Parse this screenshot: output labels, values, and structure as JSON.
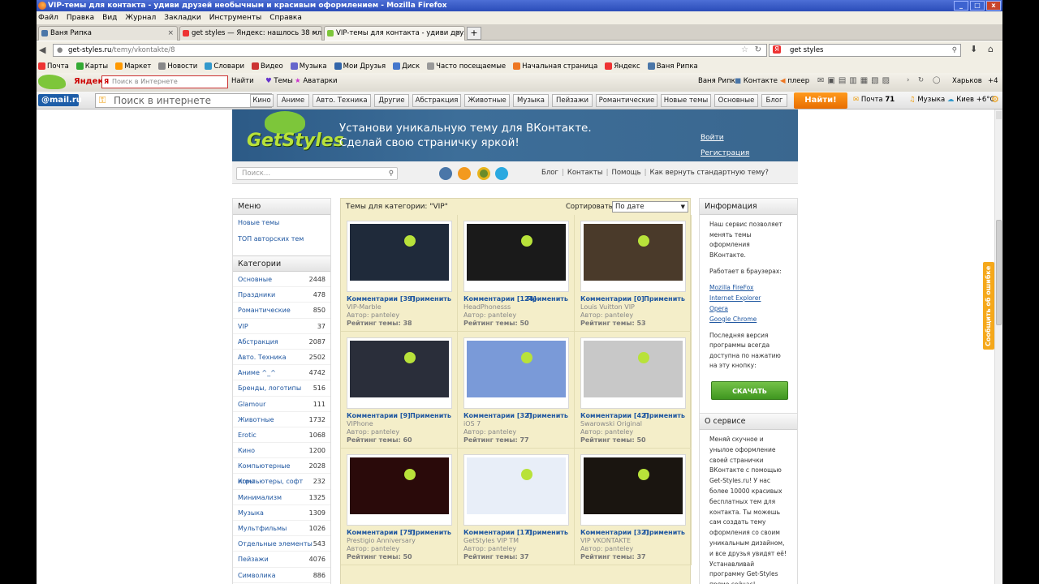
{
  "window": {
    "title": "VIP-темы для контакта - удиви друзей необычным и красивым оформлением - Mozilla Firefox",
    "controls": [
      "_",
      "□",
      "x"
    ]
  },
  "menubar": [
    "Файл",
    "Правка",
    "Вид",
    "Журнал",
    "Закладки",
    "Инструменты",
    "Справка"
  ],
  "tabs": [
    {
      "label": "Ваня Рипка",
      "close": "×"
    },
    {
      "label": "get styles — Яндекс: нашлось 38 млн о...",
      "close": "×"
    },
    {
      "label": "VIP-темы для контакта - удиви друзе...",
      "close": "×"
    }
  ],
  "newtab": "+",
  "navbar": {
    "url_host": "get-styles.ru",
    "url_path": "/temy/vkontakte/8",
    "search_value": "get styles"
  },
  "bookmarks": [
    "Почта",
    "Карты",
    "Маркет",
    "Новости",
    "Словари",
    "Видео",
    "Музыка",
    "Мои Друзья",
    "Диск",
    "Часто посещаемые",
    "Начальная страница",
    "Яндекс",
    "Ваня Рипка"
  ],
  "yandex_bar": {
    "brand": "Яндекс",
    "search_placeholder": "Поиск в Интернете",
    "go": "Найти",
    "themes": "Темы",
    "avatars": "Аватарки",
    "user": "Ваня Рипка",
    "vk": "Контакте",
    "player": "плеер",
    "weather": "Харьков",
    "temp": "+4"
  },
  "mail_bar": {
    "logo": "@mail.ru",
    "search_placeholder": "Поиск в интернете",
    "categories": [
      "Кино",
      "Аниме",
      "Авто. Техника",
      "Другие",
      "Абстракция",
      "Животные",
      "Музыка",
      "Пейзажи",
      "Романтические",
      "Новые темы",
      "Основные",
      "Блог"
    ],
    "find": "Найти!",
    "mail": "Почта",
    "mail_count": "71",
    "music": "Музыка",
    "weather": "Киев +6°C"
  },
  "site": {
    "logo": "GetStyles",
    "tagline_1": "Установи уникальную тему для ВКонтакте.",
    "tagline_2": "Сделай свою страничку яркой!",
    "login": "Войти",
    "register": "Регистрация",
    "search_placeholder": "Поиск...",
    "toplinks": [
      "Блог",
      "Контакты",
      "Помощь",
      "Как вернуть стандартную тему?"
    ],
    "report_tab": "Сообщить об ошибке"
  },
  "menu": {
    "title": "Меню",
    "items": [
      "Новые темы",
      "ТОП авторских тем"
    ]
  },
  "categories": {
    "title": "Категории",
    "items": [
      {
        "name": "Основные",
        "count": "2448"
      },
      {
        "name": "Праздники",
        "count": "478"
      },
      {
        "name": "Романтические",
        "count": "850"
      },
      {
        "name": "VIP",
        "count": "37"
      },
      {
        "name": "Абстракция",
        "count": "2087"
      },
      {
        "name": "Авто. Техника",
        "count": "2502"
      },
      {
        "name": "Аниме ^_^",
        "count": "4742"
      },
      {
        "name": "Бренды, логотипы",
        "count": "516"
      },
      {
        "name": "Glamour",
        "count": "111"
      },
      {
        "name": "Животные",
        "count": "1732"
      },
      {
        "name": "Erotic",
        "count": "1068"
      },
      {
        "name": "Кино",
        "count": "1200"
      },
      {
        "name": "Компьютерные игры",
        "count": "2028"
      },
      {
        "name": "Компьютеры, софт",
        "count": "232"
      },
      {
        "name": "Минимализм",
        "count": "1325"
      },
      {
        "name": "Музыка",
        "count": "1309"
      },
      {
        "name": "Мультфильмы",
        "count": "1026"
      },
      {
        "name": "Отдельные элементы",
        "count": "543"
      },
      {
        "name": "Пейзажи",
        "count": "4076"
      },
      {
        "name": "Символика",
        "count": "886"
      }
    ]
  },
  "themes": {
    "title": "Темы для категории: \"VIP\"",
    "sort_label": "Сортировать:",
    "sort_value": "По дате",
    "apply_label": "Применить",
    "cards": [
      {
        "comments": "Комментарии [39]",
        "name": "VIP-Marble",
        "author": "Автор: panteley",
        "rating": "Рейтинг темы: 38",
        "color": "#1f2a3a"
      },
      {
        "comments": "Комментарии [124]",
        "name": "HeadPhonesss",
        "author": "Автор: panteley",
        "rating": "Рейтинг темы: 50",
        "color": "#1a1a1a"
      },
      {
        "comments": "Комментарии [0]",
        "name": "Louis Vuitton VIP",
        "author": "Автор: panteley",
        "rating": "Рейтинг темы: 53",
        "color": "#4a3a2a"
      },
      {
        "comments": "Комментарии [9]",
        "name": "VIPhone",
        "author": "Автор: panteley",
        "rating": "Рейтинг темы: 60",
        "color": "#2a2e3a"
      },
      {
        "comments": "Комментарии [32]",
        "name": "iOS 7",
        "author": "Автор: panteley",
        "rating": "Рейтинг темы: 77",
        "color": "#7a9ad8"
      },
      {
        "comments": "Комментарии [42]",
        "name": "Swarowski Original",
        "author": "Автор: panteley",
        "rating": "Рейтинг темы: 50",
        "color": "#c8c8c8"
      },
      {
        "comments": "Комментарии [75]",
        "name": "Prestigio Anniversary",
        "author": "Автор: panteley",
        "rating": "Рейтинг темы: 50",
        "color": "#2a0a0a"
      },
      {
        "comments": "Комментарии [17]",
        "name": "GetStyles VIP TM",
        "author": "Автор: panteley",
        "rating": "Рейтинг темы: 37",
        "color": "#e8eef8"
      },
      {
        "comments": "Комментарии [32]",
        "name": "VIP VKONTAKTE",
        "author": "Автор: panteley",
        "rating": "Рейтинг темы: 37",
        "color": "#1a1510"
      }
    ]
  },
  "info": {
    "title": "Информация",
    "text_1": "Наш сервис позволяет менять темы оформления ВКонтакте.",
    "text_2": "Работает в браузерах:",
    "browsers": [
      "Mozilla FireFox",
      "Internet Explorer",
      "Opera",
      "Google Chrome"
    ],
    "text_3": "Последняя версия программы всегда доступна по нажатию на эту кнопку:",
    "download": "СКАЧАТЬ"
  },
  "about": {
    "title": "О сервисе",
    "text": "Меняй скучное и унылое оформление своей странички ВКонтакте с помощью Get-Styles.ru! У нас более 10000 красивых бесплатных тем для контакта. Ты можешь сам создать тему оформления со своим уникальным дизайном, и все друзья увидят её! Устанавливай программу Get-Styles прямо сейчас!"
  }
}
